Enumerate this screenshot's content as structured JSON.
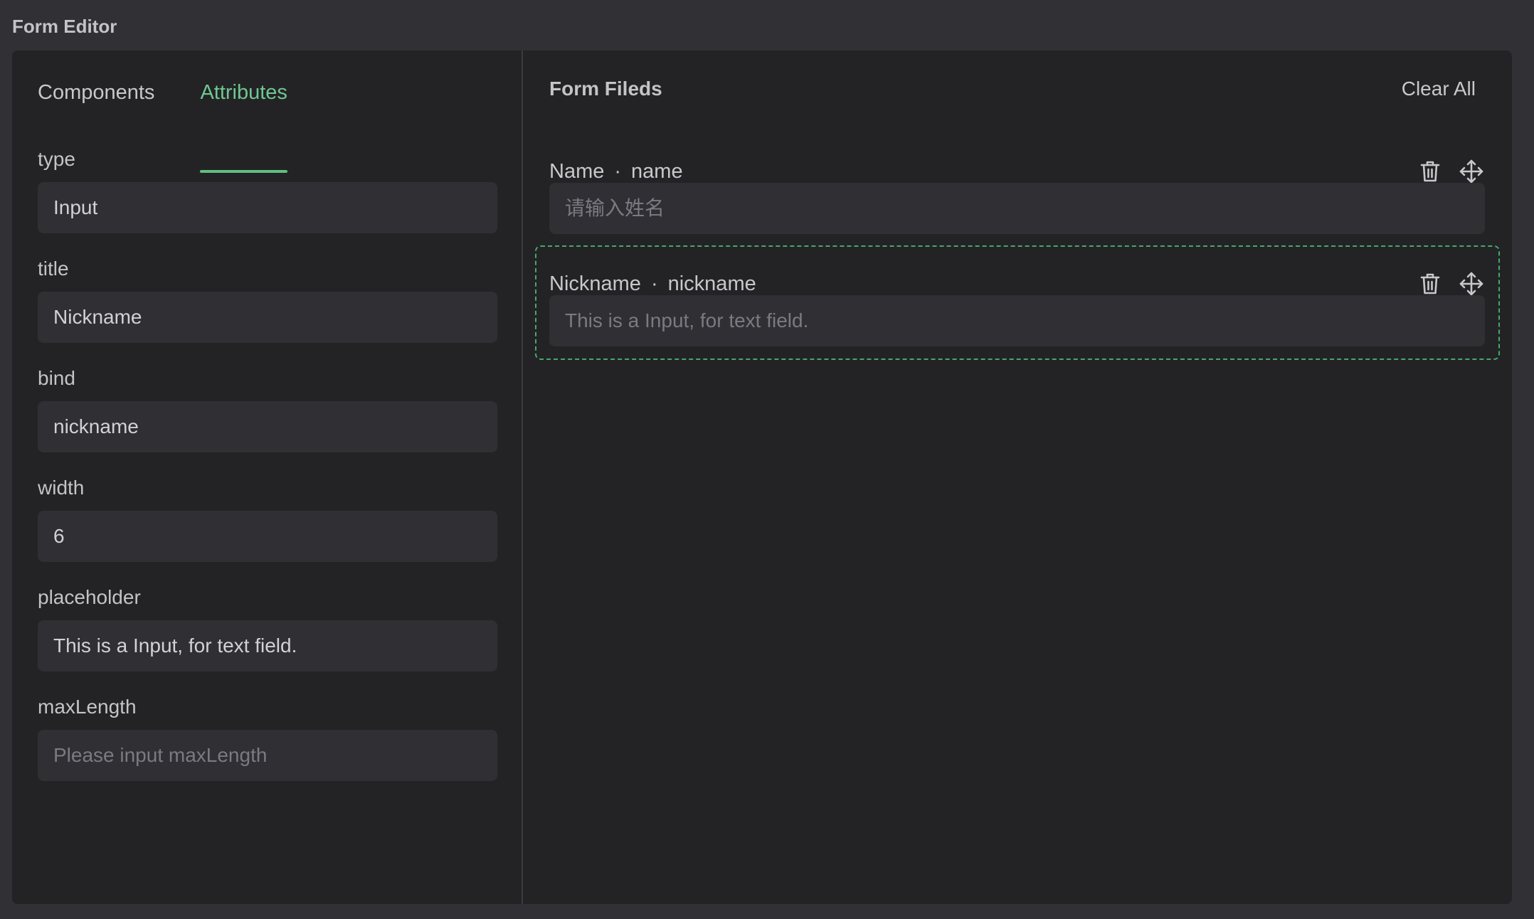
{
  "app": {
    "title": "Form Editor"
  },
  "tabs": [
    {
      "label": "Components",
      "active": false
    },
    {
      "label": "Attributes",
      "active": true
    }
  ],
  "attributes": {
    "type": {
      "label": "type",
      "value": "Input",
      "placeholder": ""
    },
    "title": {
      "label": "title",
      "value": "Nickname",
      "placeholder": ""
    },
    "bind": {
      "label": "bind",
      "value": "nickname",
      "placeholder": ""
    },
    "width": {
      "label": "width",
      "value": "6",
      "placeholder": ""
    },
    "placeholder": {
      "label": "placeholder",
      "value": "This is a Input, for text field.",
      "placeholder": ""
    },
    "maxLength": {
      "label": "maxLength",
      "value": "",
      "placeholder": "Please input maxLength"
    }
  },
  "form": {
    "title": "Form Fileds",
    "clear_label": "Clear All",
    "separator": "·",
    "items": [
      {
        "title": "Name",
        "bind": "name",
        "placeholder": "请输入姓名",
        "selected": false
      },
      {
        "title": "Nickname",
        "bind": "nickname",
        "placeholder": "This is a Input, for text field.",
        "selected": true
      }
    ]
  },
  "colors": {
    "background": "#303035",
    "panel": "#232326",
    "input": "#2f2f34",
    "accent": "#6fc78f",
    "selection_border": "#46a86b",
    "text": "#c8c8cc"
  },
  "icons": {
    "delete": "trash-icon",
    "move": "move-arrows-icon"
  }
}
